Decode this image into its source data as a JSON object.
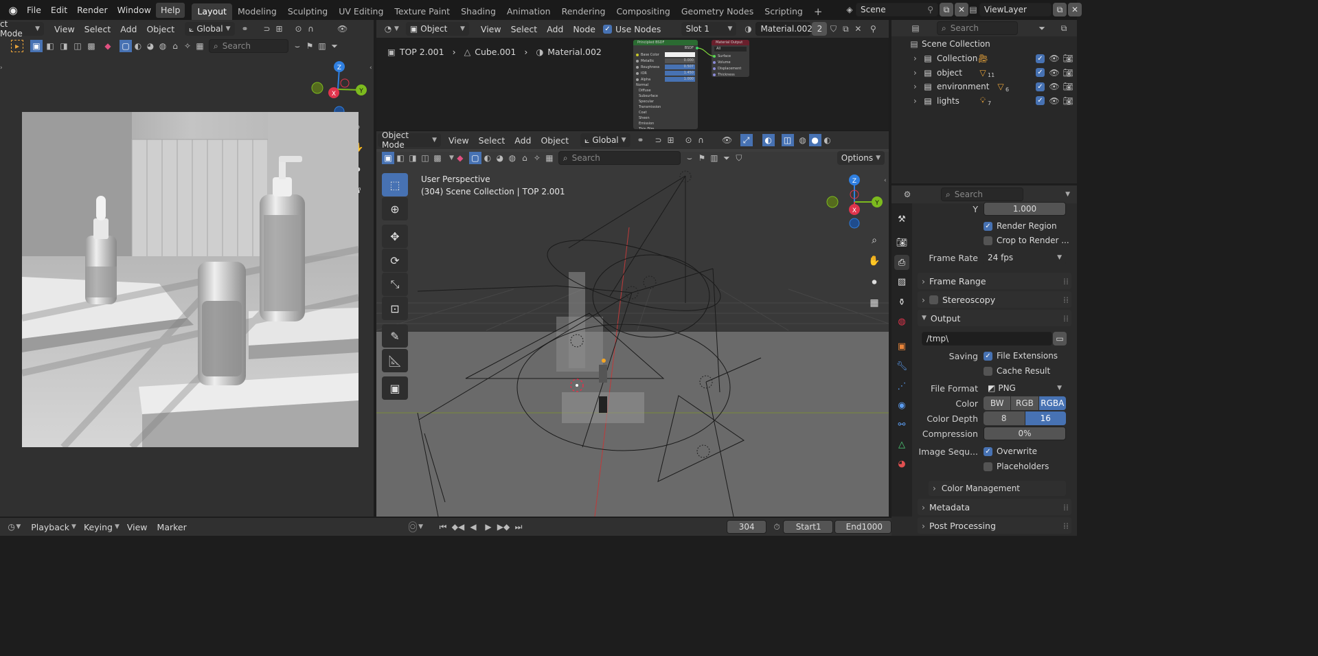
{
  "menu": [
    "File",
    "Edit",
    "Render",
    "Window",
    "Help"
  ],
  "workspaces": [
    "Layout",
    "Modeling",
    "Sculpting",
    "UV Editing",
    "Texture Paint",
    "Shading",
    "Animation",
    "Rendering",
    "Compositing",
    "Geometry Nodes",
    "Scripting"
  ],
  "add_tab": "+",
  "scene": {
    "label": "Scene"
  },
  "view_layer": {
    "label": "ViewLayer"
  },
  "left_editor": {
    "mode": "ct Mode",
    "menus": [
      "View",
      "Select",
      "Add",
      "Object"
    ],
    "orientation": "Global",
    "search_placeholder": "Search",
    "gizmo": {
      "z": "Z",
      "y": "Y",
      "x": "X"
    }
  },
  "shader_editor": {
    "type": "Object",
    "menus": [
      "View",
      "Select",
      "Add",
      "Node"
    ],
    "use_nodes": "Use Nodes",
    "slot": "Slot 1",
    "material": "Material.002",
    "users": "2",
    "breadcrumb": [
      "TOP 2.001",
      "Cube.001",
      "Material.002"
    ],
    "node_bsdf": {
      "title": "Principled BSDF",
      "out": "BSDF",
      "rows": [
        {
          "label": "Base Color",
          "value": ""
        },
        {
          "label": "Metallic",
          "value": "0.000"
        },
        {
          "label": "Roughness",
          "value": "0.507"
        },
        {
          "label": "IOR",
          "value": "1.450"
        },
        {
          "label": "Alpha",
          "value": "1.000"
        }
      ],
      "sections": [
        "Normal",
        "Diffuse",
        "Subsurface",
        "Specular",
        "Transmission",
        "Coat",
        "Sheen",
        "Emission",
        "Thin Film"
      ]
    },
    "node_output": {
      "title": "Material Output",
      "target": "All",
      "inputs": [
        "Surface",
        "Volume",
        "Displacement",
        "Thickness"
      ]
    }
  },
  "viewport": {
    "mode": "Object Mode",
    "menus": [
      "View",
      "Select",
      "Add",
      "Object"
    ],
    "orientation": "Global",
    "search_placeholder": "Search",
    "options": "Options",
    "info_line1": "User Perspective",
    "info_line2": "(304) Scene Collection | TOP 2.001",
    "gizmo": {
      "z": "Z",
      "y": "Y",
      "x": "X"
    }
  },
  "outliner": {
    "search_placeholder": "Search",
    "root": "Scene Collection",
    "items": [
      {
        "label": "Collection",
        "count": ""
      },
      {
        "label": "object",
        "count": "11"
      },
      {
        "label": "environment",
        "count": "6"
      },
      {
        "label": "lights",
        "count": "7"
      }
    ]
  },
  "properties": {
    "search_placeholder": "Search",
    "y_label": "Y",
    "y_value": "1.000",
    "render_region": "Render Region",
    "crop": "Crop to Render ...",
    "frame_rate_label": "Frame Rate",
    "frame_rate": "24 fps",
    "frame_range": "Frame Range",
    "stereoscopy": "Stereoscopy",
    "output": "Output",
    "path": "/tmp\\",
    "saving_label": "Saving",
    "file_ext": "File Extensions",
    "cache_result": "Cache Result",
    "file_format_label": "File Format",
    "file_format": "PNG",
    "color_label": "Color",
    "color_opts": [
      "BW",
      "RGB",
      "RGBA"
    ],
    "depth_label": "Color Depth",
    "depth_opts": [
      "8",
      "16"
    ],
    "compression_label": "Compression",
    "compression": "0%",
    "image_seq_label": "Image Sequ...",
    "overwrite": "Overwrite",
    "placeholders": "Placeholders",
    "color_mgmt": "Color Management",
    "metadata": "Metadata",
    "post_processing": "Post Processing"
  },
  "timeline": {
    "menus": [
      "Playback",
      "Keying",
      "View",
      "Marker"
    ],
    "frame": "304",
    "start_label": "Start",
    "start": "1",
    "end_label": "End",
    "end": "1000"
  },
  "colors": {
    "accent": "#4772b3",
    "gizmo_x": "#e0344c",
    "gizmo_y": "#7dbb1e",
    "gizmo_z": "#2f7fe0"
  }
}
